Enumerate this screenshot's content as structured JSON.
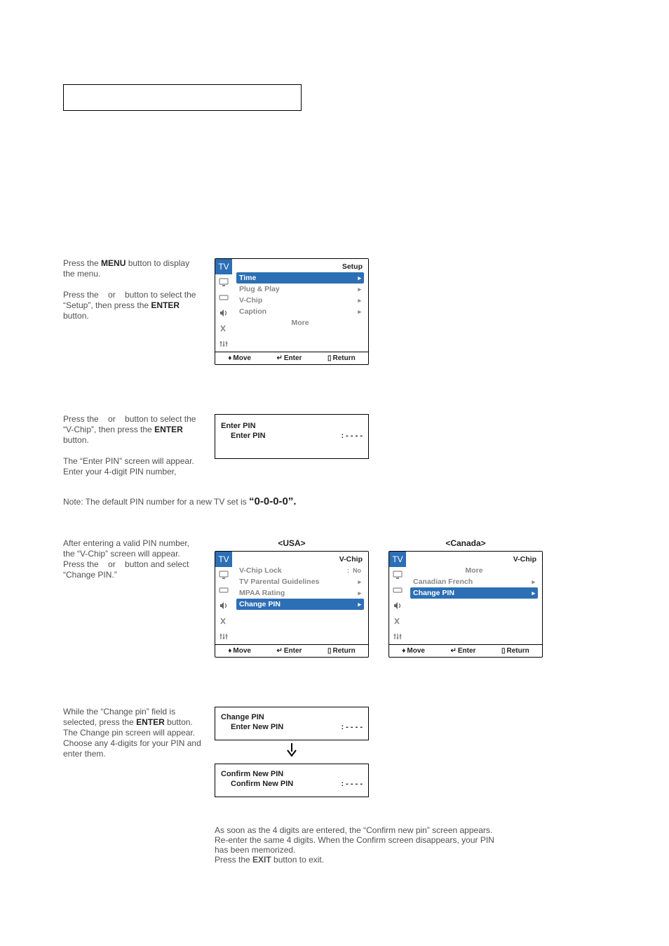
{
  "instructions": {
    "step1a": "Press the ",
    "step1a_b": "MENU",
    "step1a_tail": " button to display the menu.",
    "step1b": "Press the    or    button to select the “Setup”, then press the ",
    "step1b_b": "ENTER",
    "step1b_tail": " button.",
    "step2": "Press the    or    button to select the “V-Chip”, then press the ",
    "step2_b": "ENTER",
    "step2_tail": " button.",
    "step2_2": "The “Enter PIN” screen will appear. Enter your 4-digit PIN number,",
    "note": "Note: The default PIN number for a new TV set is ",
    "note_code": "“0-0-0-0”.",
    "step3": "After entering a valid PIN number, the “V-Chip” screen will appear.\nPress the    or    button and select “Change PIN.”",
    "step4a": "While the “Change pin” field is selected, press the ",
    "step4a_b": "ENTER",
    "step4a_tail": " button.",
    "step4b": "The Change pin screen will appear. Choose any 4-digits for your PIN and enter them.",
    "step4_note": "As soon as the 4 digits are entered, the “Confirm new pin” screen appears. Re-enter the same 4 digits. When the Confirm screen disappears, your PIN has been memorized.\nPress the ",
    "step4_note_b": "EXIT",
    "step4_note_tail": " button to exit."
  },
  "screens": {
    "setup": {
      "title_tag": "TV",
      "title": "Setup",
      "items": [
        {
          "label": "Time",
          "tail": "▸",
          "sel": true
        },
        {
          "label": "Plug & Play",
          "tail": "▸",
          "sel": false
        },
        {
          "label": "V-Chip",
          "tail": "▸",
          "sel": false
        },
        {
          "label": "Caption",
          "tail": "▸",
          "sel": false
        },
        {
          "label": "More",
          "tail": "",
          "sel": false,
          "center": true
        }
      ],
      "foot": {
        "move": "Move",
        "enter": "Enter",
        "return": "Return"
      }
    },
    "pin_enter": {
      "box_title": "Enter PIN",
      "line_label": "Enter PIN",
      "dots": ": - - - -"
    },
    "usa": {
      "heading": "<USA>",
      "title_tag": "TV",
      "title": "V-Chip",
      "items": [
        {
          "label": "V-Chip Lock",
          "tail": ":  No",
          "sel": false
        },
        {
          "label": "TV Parental Guidelines",
          "tail": "▸",
          "sel": false
        },
        {
          "label": "MPAA Rating",
          "tail": "▸",
          "sel": false
        },
        {
          "label": "Change PIN",
          "tail": "▸",
          "sel": true
        }
      ],
      "foot": {
        "move": "Move",
        "enter": "Enter",
        "return": "Return"
      }
    },
    "canada": {
      "heading": "<Canada>",
      "title_tag": "TV",
      "title": "V-Chip",
      "items": [
        {
          "label": "More",
          "tail": "",
          "sel": false,
          "center": true
        },
        {
          "label": "Canadian French",
          "tail": "▸",
          "sel": false
        },
        {
          "label": "Change PIN",
          "tail": "▸",
          "sel": true
        }
      ],
      "foot": {
        "move": "Move",
        "enter": "Enter",
        "return": "Return"
      }
    },
    "change_pin": {
      "box_title": "Change PIN",
      "line_label": "Enter New PIN",
      "dots": ": - - - -"
    },
    "confirm_pin": {
      "box_title": "Confirm New PIN",
      "line_label": "Confirm New PIN",
      "dots": ": - - - -"
    }
  }
}
